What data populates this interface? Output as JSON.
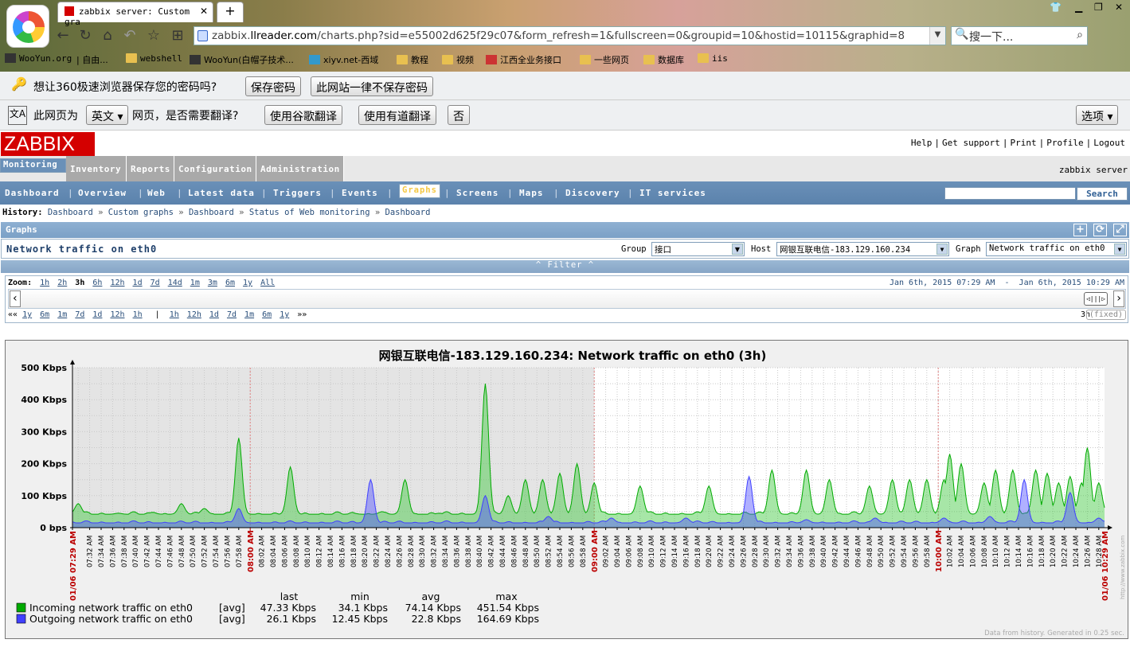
{
  "browser": {
    "tab_title": "zabbix server: Custom gra",
    "new_tab": "+",
    "url_prefix": "zabbix.",
    "url_domain": "llreader.com",
    "url_rest": "/charts.php?sid=e55002d625f29c07&form_refresh=1&fullscreen=0&groupid=10&hostid=10115&graphid=8",
    "search_placeholder": "搜一下...",
    "bookmarks": [
      "WooYun.org",
      "自由...",
      "webshell",
      "WooYun(白帽子技术...",
      "xiyv.net-西域",
      "教程",
      "视频",
      "江西全业务接口",
      "一些网页",
      "数据库",
      "iis"
    ]
  },
  "password_bar": {
    "text": "想让360极速浏览器保存您的密码吗?",
    "save": "保存密码",
    "never": "此网站一律不保存密码"
  },
  "translate_bar": {
    "prefix": "此网页为",
    "lang": "英文",
    "suffix": "网页，是否需要翻译?",
    "google": "使用谷歌翻译",
    "youdao": "使用有道翻译",
    "no": "否",
    "options": "选项"
  },
  "zabbix": {
    "logo": "ZABBIX",
    "toplinks": [
      "Help",
      "Get support",
      "Print",
      "Profile",
      "Logout"
    ],
    "main_menu": [
      "Monitoring",
      "Inventory",
      "Reports",
      "Configuration",
      "Administration"
    ],
    "server_name": "zabbix server",
    "sub_menu": [
      "Dashboard",
      "Overview",
      "Web",
      "Latest data",
      "Triggers",
      "Events",
      "Graphs",
      "Screens",
      "Maps",
      "Discovery",
      "IT services"
    ],
    "search_button": "Search",
    "history_label": "History:",
    "history": [
      "Dashboard",
      "Custom graphs",
      "Dashboard",
      "Status of Web monitoring",
      "Dashboard"
    ],
    "section_title": "Graphs",
    "graph_name": "Network traffic on eth0",
    "group_label": "Group",
    "group_value": "接口",
    "host_label": "Host",
    "host_value": "网银互联电信-183.129.160.234",
    "graph_label": "Graph",
    "graph_value": "Network traffic on eth0",
    "filter": "Filter",
    "zoom_label": "Zoom:",
    "zoom_links": [
      "1h",
      "2h",
      "3h",
      "6h",
      "12h",
      "1d",
      "7d",
      "14d",
      "1m",
      "3m",
      "6m",
      "1y",
      "All"
    ],
    "zoom_current": "3h",
    "date_from": "Jan 6th, 2015 07:29 AM",
    "date_sep": "-",
    "date_to": "Jan 6th, 2015 10:29 AM",
    "nav_back": "««",
    "nav_back_links": [
      "1y",
      "6m",
      "1m",
      "7d",
      "1d",
      "12h",
      "1h"
    ],
    "nav_fwd_links": [
      "1h",
      "12h",
      "1d",
      "7d",
      "1m",
      "6m",
      "1y"
    ],
    "nav_fwd": "»»",
    "period": "3h",
    "fixed": "(fixed)"
  },
  "chart_data": {
    "type": "area",
    "title": "网银互联电信-183.129.160.234: Network traffic on eth0 (3h)",
    "y_ticks": [
      "500 Kbps",
      "400 Kbps",
      "300 Kbps",
      "200 Kbps",
      "100 Kbps",
      "0 bps"
    ],
    "ylim": [
      0,
      500
    ],
    "x_start_label": "01/06 07:29 AM",
    "x_end_label": "01/06 10:29 AM",
    "x_major_labels": [
      "08:00 AM",
      "09:00 AM",
      "10:00 AM"
    ],
    "x_minutes_start": 449,
    "x_minutes_end": 629,
    "series": [
      {
        "name": "Incoming network traffic on eth0",
        "func": "[avg]",
        "last": "47.33 Kbps",
        "min": "34.1 Kbps",
        "avg": "74.14 Kbps",
        "max": "451.54 Kbps",
        "color": "#00aa00",
        "peaks": [
          [
            450,
            75
          ],
          [
            457,
            45
          ],
          [
            463,
            48
          ],
          [
            468,
            75
          ],
          [
            472,
            60
          ],
          [
            478,
            280
          ],
          [
            487,
            190
          ],
          [
            498,
            45
          ],
          [
            503,
            50
          ],
          [
            507,
            150
          ],
          [
            513,
            45
          ],
          [
            521,
            450
          ],
          [
            525,
            100
          ],
          [
            528,
            150
          ],
          [
            531,
            150
          ],
          [
            534,
            170
          ],
          [
            537,
            200
          ],
          [
            540,
            140
          ],
          [
            548,
            130
          ],
          [
            560,
            130
          ],
          [
            571,
            180
          ],
          [
            577,
            180
          ],
          [
            581,
            150
          ],
          [
            588,
            130
          ],
          [
            592,
            150
          ],
          [
            595,
            150
          ],
          [
            598,
            150
          ],
          [
            601,
            150
          ],
          [
            602,
            230
          ],
          [
            604,
            200
          ],
          [
            608,
            140
          ],
          [
            610,
            180
          ],
          [
            613,
            180
          ],
          [
            617,
            180
          ],
          [
            619,
            170
          ],
          [
            621,
            140
          ],
          [
            623,
            160
          ],
          [
            625,
            140
          ],
          [
            626,
            250
          ],
          [
            628,
            140
          ]
        ]
      },
      {
        "name": "Outgoing network traffic on eth0",
        "func": "[avg]",
        "last": "26.1 Kbps",
        "min": "12.45 Kbps",
        "avg": "22.8 Kbps",
        "max": "164.69 Kbps",
        "color": "#4040ff",
        "peaks": [
          [
            478,
            60
          ],
          [
            501,
            150
          ],
          [
            521,
            100
          ],
          [
            532,
            35
          ],
          [
            543,
            30
          ],
          [
            556,
            30
          ],
          [
            567,
            160
          ],
          [
            577,
            25
          ],
          [
            589,
            30
          ],
          [
            601,
            30
          ],
          [
            609,
            35
          ],
          [
            615,
            150
          ],
          [
            623,
            110
          ],
          [
            628,
            30
          ]
        ]
      }
    ],
    "legend_headers": [
      "last",
      "min",
      "avg",
      "max"
    ],
    "footer": "Data from history. Generated in 0.25 sec.",
    "watermark": "http://www.zabbix.com"
  }
}
